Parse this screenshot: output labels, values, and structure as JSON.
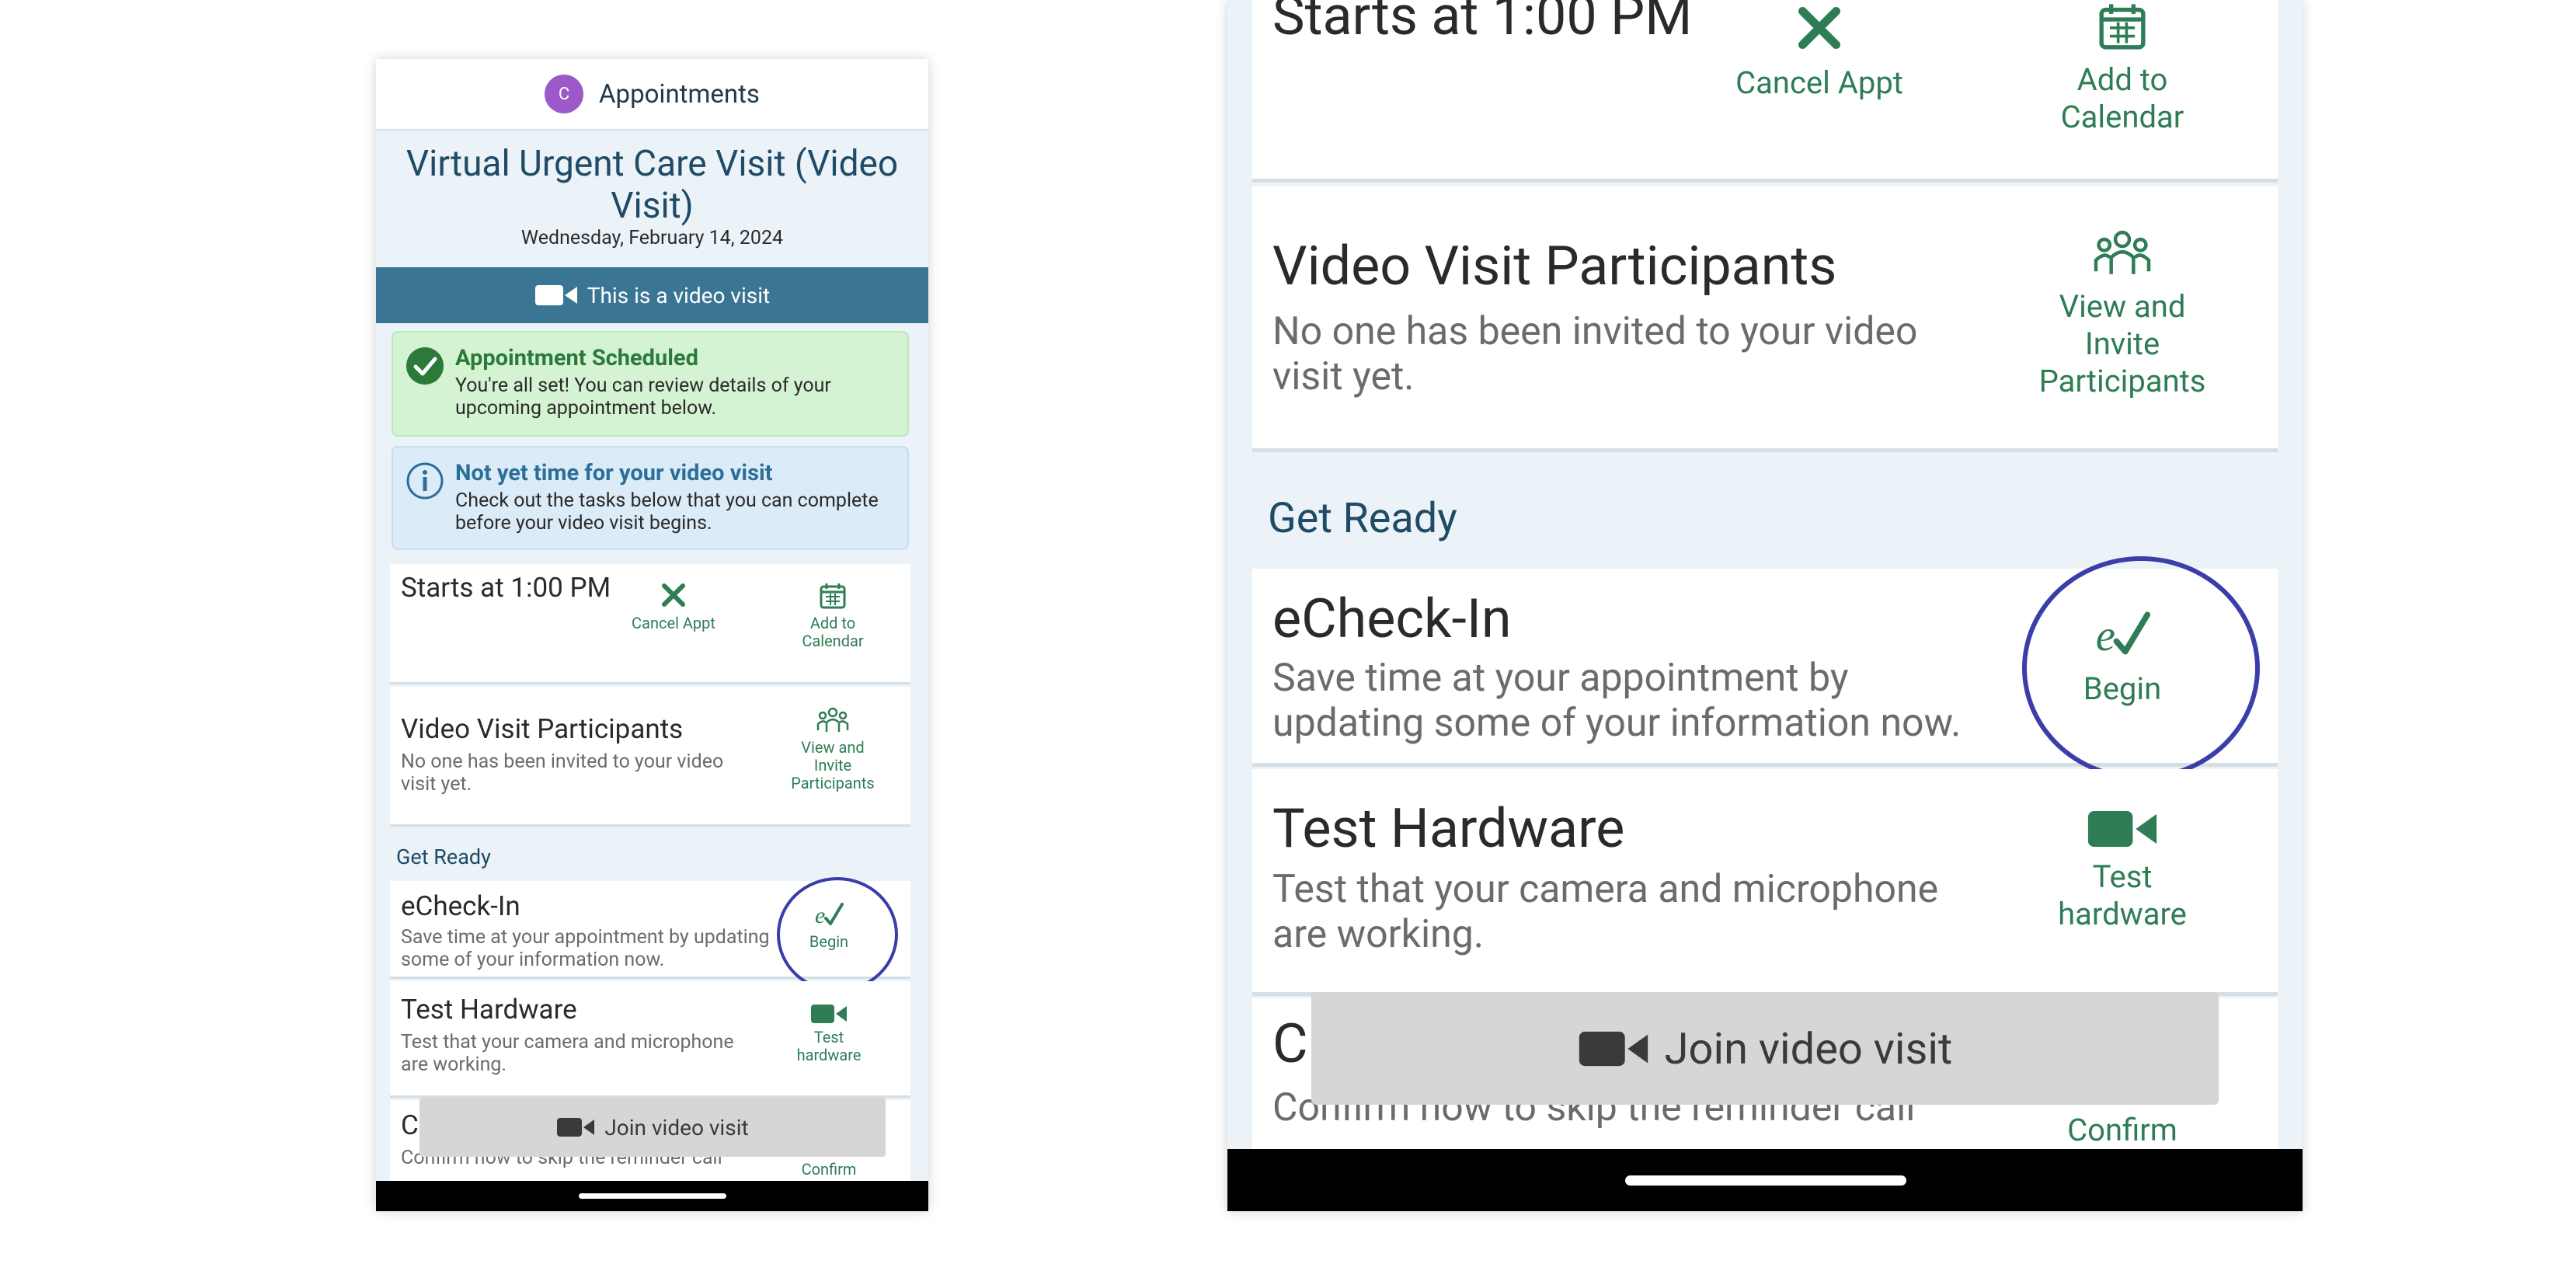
{
  "header": {
    "avatar_initial": "C",
    "title": "Appointments"
  },
  "visit": {
    "title": "Virtual Urgent Care Visit (Video Visit)",
    "date": "Wednesday, February 14, 2024",
    "video_banner": "This is a video visit"
  },
  "alerts": {
    "scheduled": {
      "title": "Appointment Scheduled",
      "body": "You're all set! You can review details of your upcoming appointment below."
    },
    "not_yet": {
      "title": "Not yet time for your video visit",
      "body": "Check out the tasks below that you can complete before your video visit begins."
    }
  },
  "start_card": {
    "title": "Starts at 1:00 PM",
    "cancel_label": "Cancel Appt",
    "calendar_label": "Add to Calendar"
  },
  "participants_card": {
    "title": "Video Visit Participants",
    "desc": "No one has been invited to your video visit yet.",
    "action_label": "View and Invite Participants"
  },
  "get_ready": {
    "label": "Get Ready"
  },
  "echeckin": {
    "title": "eCheck-In",
    "desc": "Save time at your appointment by updating some of your information now.",
    "action_label": "Begin"
  },
  "hardware": {
    "title": "Test Hardware",
    "desc": "Test that your camera and microphone are working.",
    "action_label": "Test hardware"
  },
  "confirm": {
    "title_visible": "C",
    "desc_visible": "Confirm now to skip the reminder call",
    "action_label": "Confirm"
  },
  "join_button": {
    "label": "Join video visit"
  },
  "colors": {
    "accent_green": "#2e7d55",
    "banner_blue": "#3a7593",
    "title_blue": "#1f4b66",
    "highlight_circle": "#3a3ea8"
  },
  "icons": [
    "video-camera-icon",
    "check-circle-icon",
    "info-icon",
    "close-icon",
    "calendar-icon",
    "participants-icon",
    "echeckin-icon"
  ]
}
